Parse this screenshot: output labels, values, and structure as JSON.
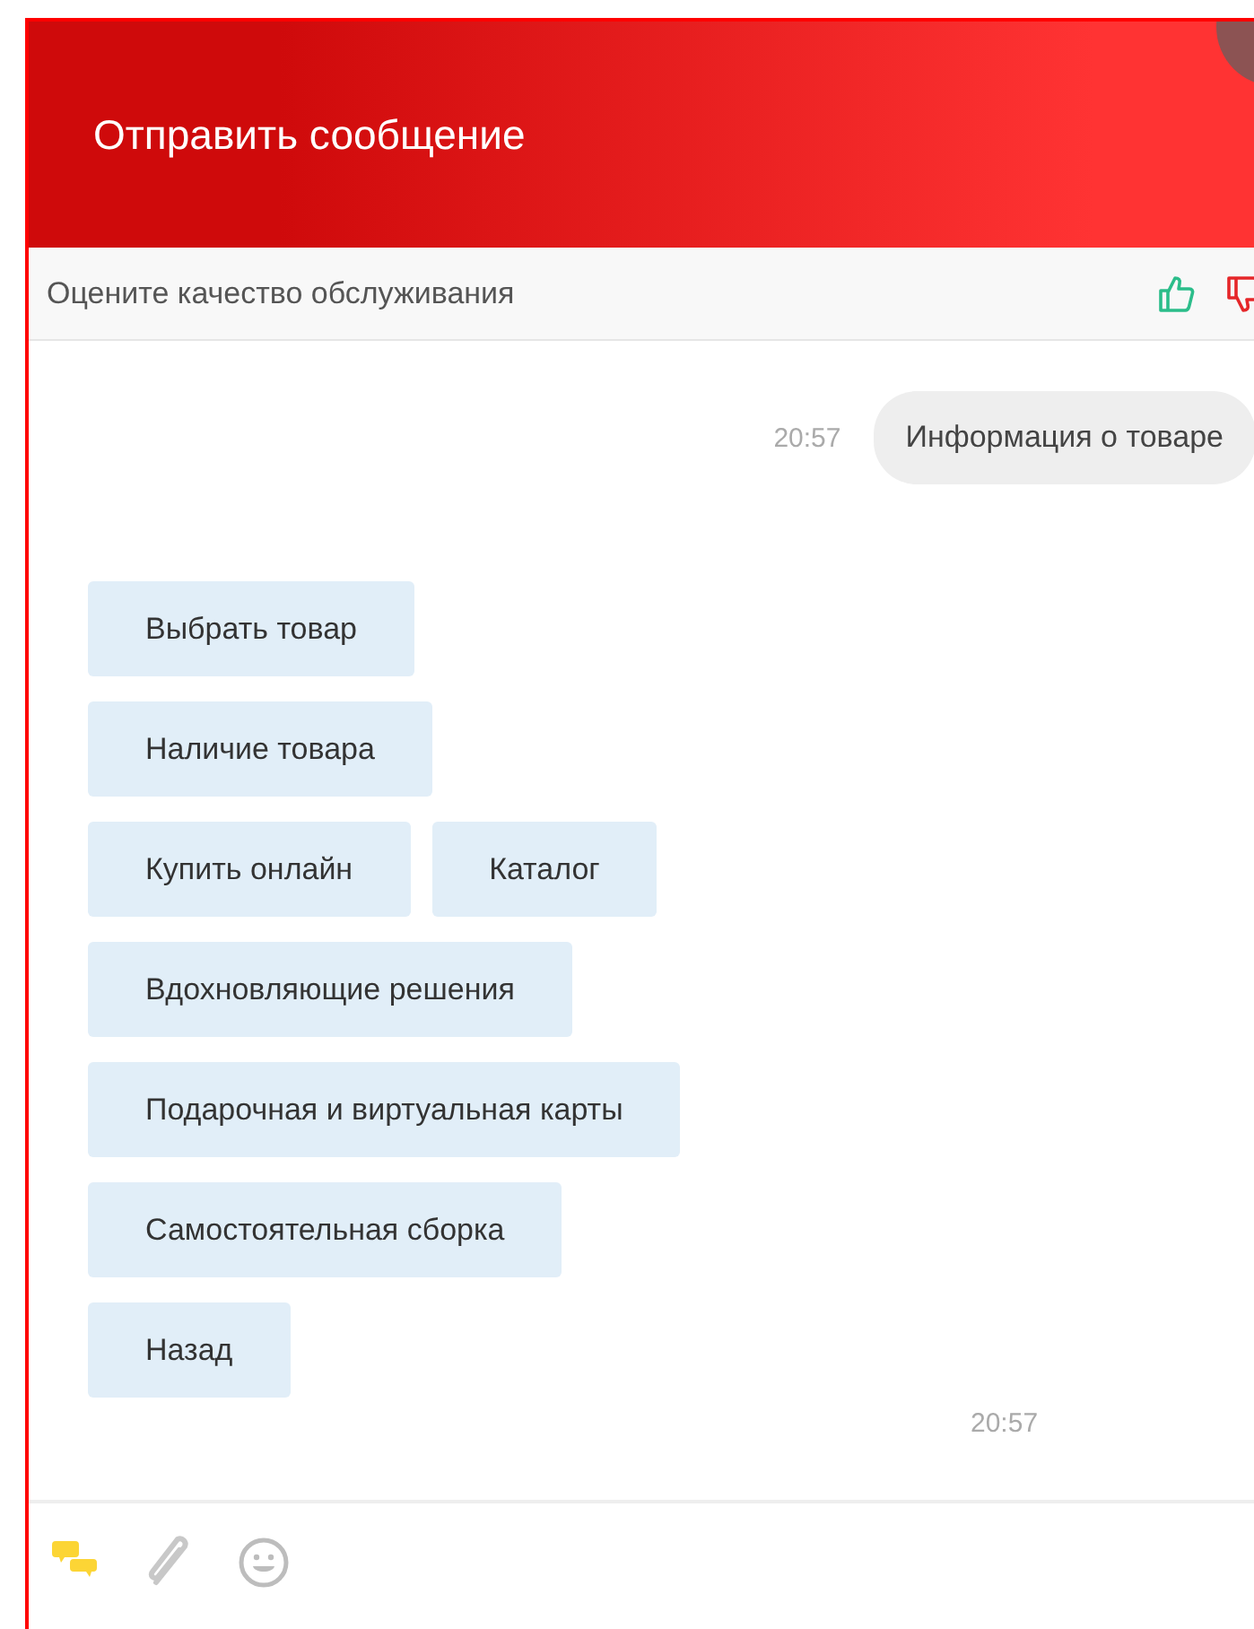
{
  "header": {
    "title": "Отправить сообщение"
  },
  "rating": {
    "prompt": "Оцените качество обслуживания"
  },
  "messages": [
    {
      "kind": "user",
      "time": "20:57",
      "text": "Информация о товаре"
    }
  ],
  "quick_replies": {
    "rows": [
      {
        "options": [
          "Выбрать товар"
        ]
      },
      {
        "options": [
          "Наличие товара"
        ]
      },
      {
        "options": [
          "Купить онлайн",
          "Каталог"
        ]
      },
      {
        "options": [
          "Вдохновляющие решения"
        ]
      },
      {
        "options": [
          "Подарочная и виртуальная карты"
        ]
      },
      {
        "options": [
          "Самостоятельная сборка"
        ]
      },
      {
        "options": [
          "Назад"
        ]
      }
    ],
    "time": "20:57"
  }
}
